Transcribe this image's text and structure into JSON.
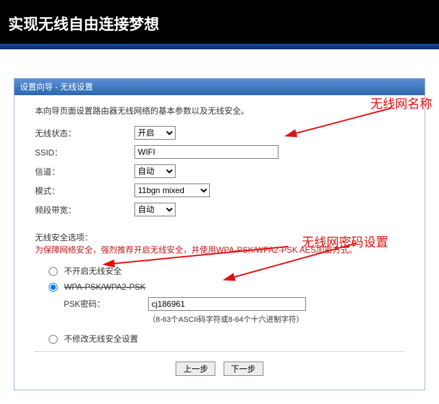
{
  "banner": {
    "title": "实现无线自由连接梦想"
  },
  "panel": {
    "title": "设置向导 - 无线设置"
  },
  "intro": "本向导页面设置路由器无线网络的基本参数以及无线安全。",
  "labels": {
    "wireless_state": "无线状态：",
    "ssid": "SSID：",
    "channel": "信道：",
    "mode": "模式：",
    "bandwidth": "频段带宽：",
    "security_option": "无线安全选项：",
    "psk_password": "PSK密码："
  },
  "values": {
    "wireless_state": "开启",
    "ssid": "WIFI",
    "channel": "自动",
    "mode": "11bgn mixed",
    "bandwidth": "自动",
    "psk_password": "cj186961"
  },
  "warn": "为保障网络安全，强烈推荐开启无线安全，并使用WPA-PSK/WPA2-PSK AES加密方式。",
  "radios": {
    "none": "不开启无线安全",
    "wpa": "WPA-PSK/WPA2-PSK",
    "nochange": "不修改无线安全设置"
  },
  "hint": "（8-63个ASCII码字符或8-64个十六进制字符）",
  "buttons": {
    "prev": "上一步",
    "next": "下一步"
  },
  "annotations": {
    "ssid_name": "无线网名称",
    "psk_name": "无线网密码设置"
  }
}
